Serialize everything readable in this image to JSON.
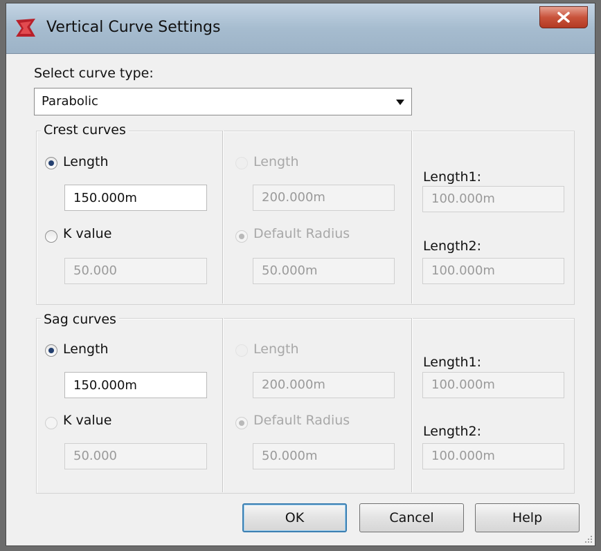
{
  "window": {
    "title": "Vertical Curve Settings"
  },
  "curve_type": {
    "label": "Select curve type:",
    "selected": "Parabolic"
  },
  "crest": {
    "title": "Crest curves",
    "length_radio": "Length",
    "length_value": "150.000m",
    "k_radio": "K value",
    "k_value": "50.000",
    "mid_length_radio": "Length",
    "mid_length_value": "200.000m",
    "default_radius_radio": "Default Radius",
    "default_radius_value": "50.000m",
    "length1_label": "Length1:",
    "length1_value": "100.000m",
    "length2_label": "Length2:",
    "length2_value": "100.000m"
  },
  "sag": {
    "title": "Sag curves",
    "length_radio": "Length",
    "length_value": "150.000m",
    "k_radio": "K value",
    "k_value": "50.000",
    "mid_length_radio": "Length",
    "mid_length_value": "200.000m",
    "default_radius_radio": "Default Radius",
    "default_radius_value": "50.000m",
    "length1_label": "Length1:",
    "length1_value": "100.000m",
    "length2_label": "Length2:",
    "length2_value": "100.000m"
  },
  "buttons": {
    "ok": "OK",
    "cancel": "Cancel",
    "help": "Help"
  },
  "icons": {
    "app": "autocad-civil-logo-icon",
    "close": "close-icon",
    "dropdown": "chevron-down-icon",
    "grip": "resize-grip-icon"
  },
  "colors": {
    "titlebar": "#a6bccf",
    "close_button": "#c9533b",
    "default_button_border": "#3c7fb1",
    "dialog_background": "#f0f0f0"
  }
}
